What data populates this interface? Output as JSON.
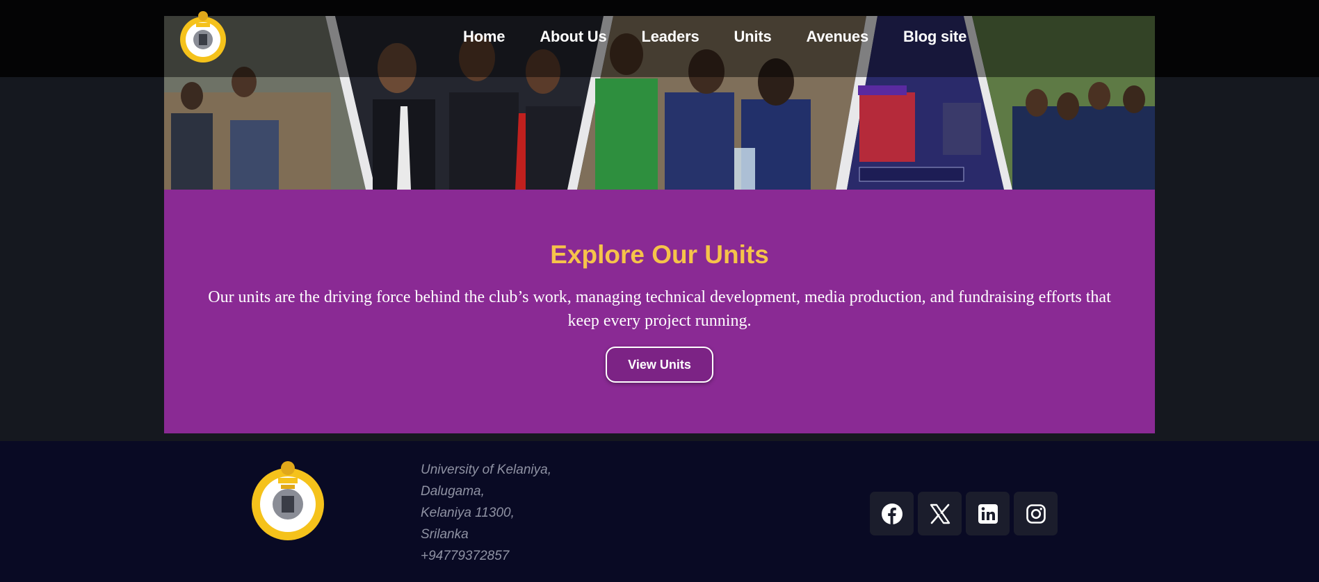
{
  "nav": {
    "items": [
      {
        "label": "Home"
      },
      {
        "label": "About Us"
      },
      {
        "label": "Leaders"
      },
      {
        "label": "Units"
      },
      {
        "label": "Avenues"
      },
      {
        "label": "Blog site"
      }
    ]
  },
  "units_section": {
    "heading": "Explore Our Units",
    "description": "Our units are the driving force behind the club’s work, managing technical development, media production, and fundraising efforts that keep every project running.",
    "button_label": "View Units"
  },
  "footer": {
    "address_lines": [
      "University of Kelaniya,",
      "Dalugama,",
      "Kelaniya 11300,",
      "Srilanka",
      "+94779372857"
    ],
    "socials": [
      {
        "icon": "facebook-icon"
      },
      {
        "icon": "x-icon"
      },
      {
        "icon": "linkedin-icon"
      },
      {
        "icon": "instagram-icon"
      }
    ]
  },
  "colors": {
    "page_bg": "#15181f",
    "section_purple": "#8a2a94",
    "heading_gold": "#f6c34a",
    "footer_bg": "#090a24",
    "logo_gold": "#f5c21b"
  }
}
